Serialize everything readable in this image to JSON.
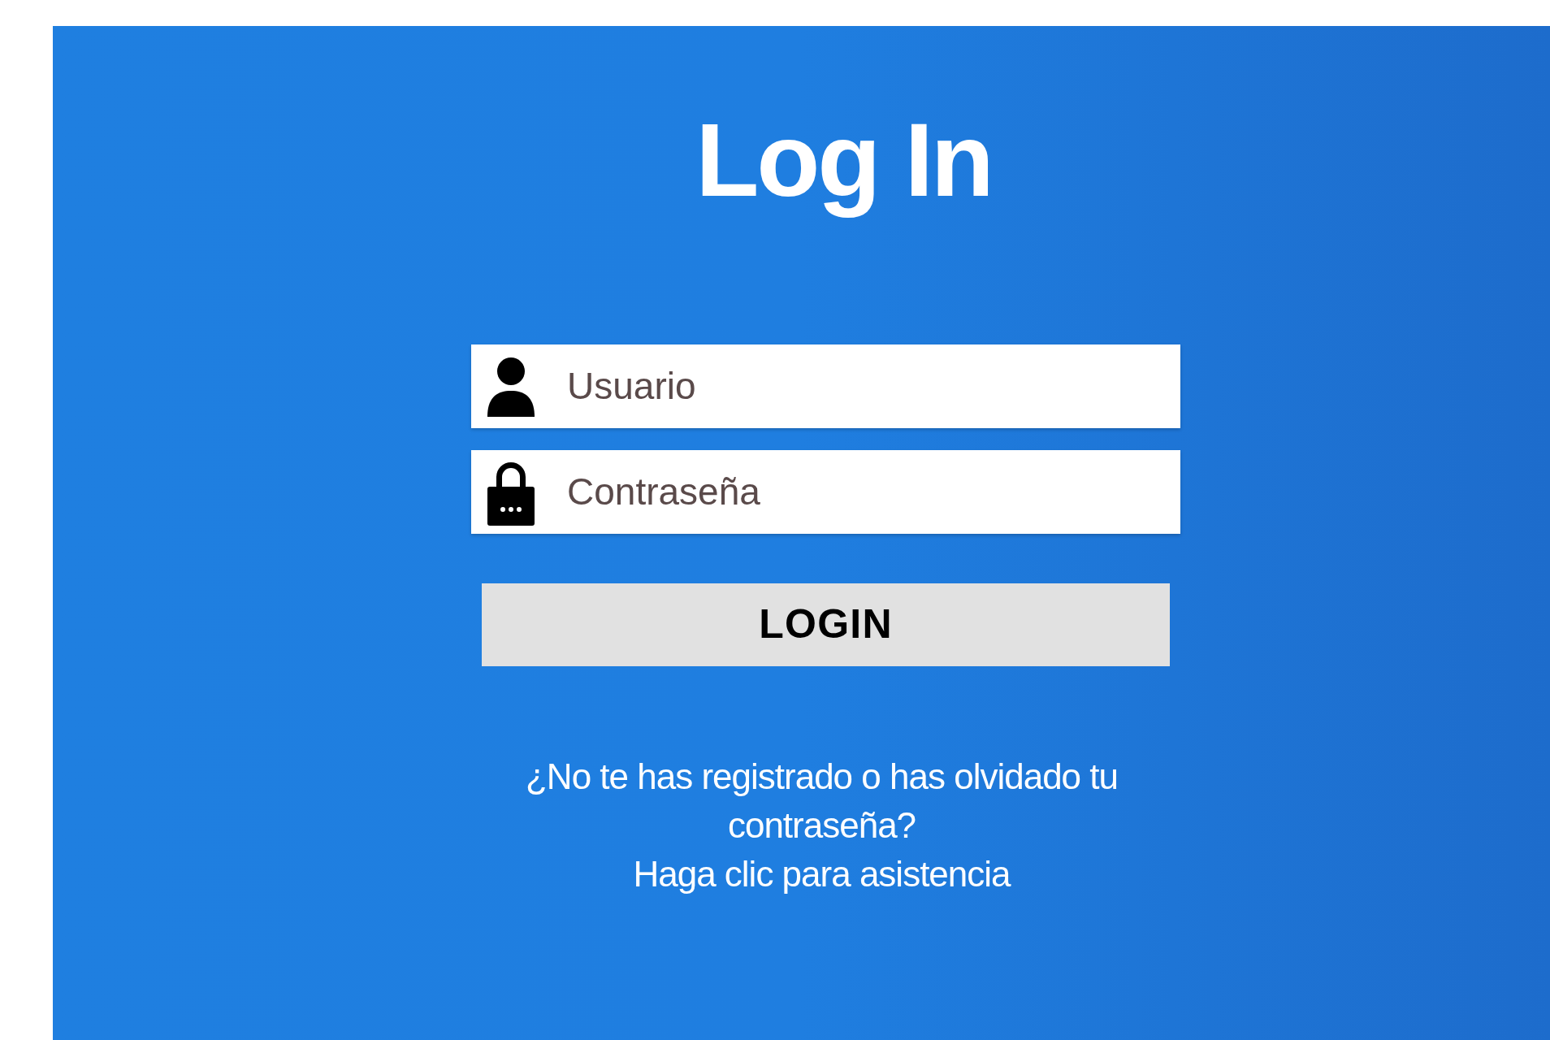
{
  "title": "Log In",
  "fields": [
    {
      "kind": "user",
      "placeholder": "Usuario"
    },
    {
      "kind": "password",
      "placeholder": "Contraseña"
    }
  ],
  "button": "LOGIN",
  "help_text": "¿No te has registrado o has olvidado tu contraseña?",
  "help_link": "Haga clic para asistencia"
}
